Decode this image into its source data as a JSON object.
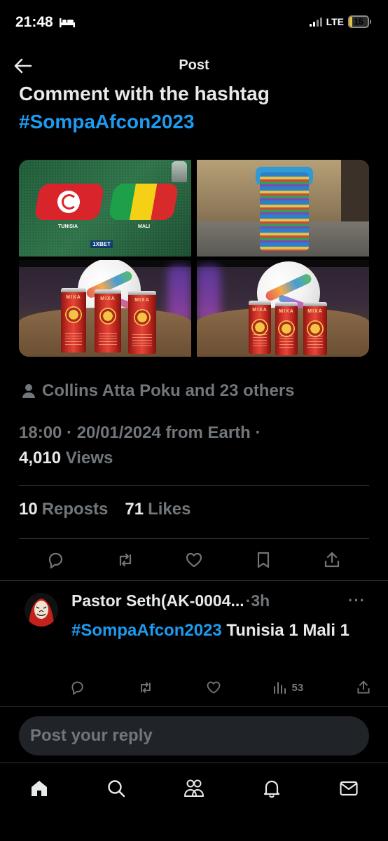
{
  "status_bar": {
    "time": "21:48",
    "network": "LTE",
    "battery": "15",
    "battery_level_percent": 15,
    "accent_color": "#f1c232"
  },
  "header": {
    "title": "Post",
    "back_icon": "arrow-left-icon"
  },
  "tweet": {
    "text_line": "Comment with the hashtag",
    "hashtag": "#SompaAfcon2023",
    "hashtag_color": "#1d9bf0",
    "media": [
      {
        "team_left": "TUNISIA",
        "team_right": "MALI",
        "sponsor": "1XBET"
      },
      {},
      {
        "can_brand": "MIXA"
      },
      {
        "can_brand": "MIXA"
      }
    ],
    "liked_by": "Collins Atta Poku and 23 others",
    "meta_line": "18:00 · 20/01/2024 from Earth ·",
    "views_count": "4,010",
    "views_label": "Views",
    "reposts_count": "10",
    "reposts_label": "Reposts",
    "likes_count": "71",
    "likes_label": "Likes",
    "action_icons": [
      "reply-icon",
      "repost-icon",
      "like-icon",
      "bookmark-icon",
      "share-icon"
    ]
  },
  "reply": {
    "author": "Pastor Seth(AK-0004...",
    "time": "·3h",
    "more": "···",
    "hashtag": "#SompaAfcon2023",
    "text_rest": " Tunisia 1 Mali 1",
    "views": "53"
  },
  "composer": {
    "placeholder": "Post your reply"
  },
  "tabbar": {
    "tabs": [
      "home-icon",
      "search-icon",
      "communities-icon",
      "notifications-icon",
      "messages-icon"
    ],
    "active": "home-icon"
  }
}
